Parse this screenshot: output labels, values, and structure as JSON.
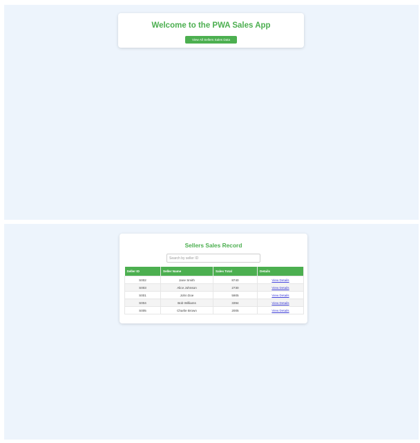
{
  "home": {
    "title": "Welcome to the PWA Sales App",
    "view_all_button": "View All Sellers Sales Data"
  },
  "records": {
    "title": "Sellers Sales Record",
    "search_placeholder": "Search by seller ID",
    "search_value": "",
    "columns": [
      "Seller ID",
      "Seller Name",
      "Sales Total",
      "Details"
    ],
    "rows": [
      {
        "id": "S002",
        "name": "Jane Smith",
        "total": "8740",
        "details": "View Details"
      },
      {
        "id": "S003",
        "name": "Alice Johnson",
        "total": "2730",
        "details": "View Details"
      },
      {
        "id": "S001",
        "name": "John Doe",
        "total": "5905",
        "details": "View Details"
      },
      {
        "id": "S004",
        "name": "Bob Williams",
        "total": "3394",
        "details": "View Details"
      },
      {
        "id": "S005",
        "name": "Charlie Brown",
        "total": "2005",
        "details": "View Details"
      }
    ]
  },
  "colors": {
    "accent": "#4caf50",
    "page_background": "#edf4fc",
    "link": "#3b3bd6"
  }
}
